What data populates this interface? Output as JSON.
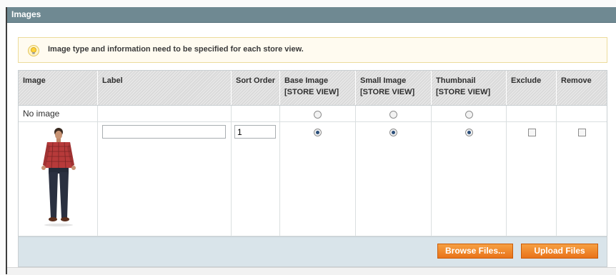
{
  "section": {
    "title": "Images"
  },
  "notice": {
    "text": "Image type and information need to be specified for each store view.",
    "icon": "lightbulb-icon"
  },
  "table": {
    "headers": {
      "image": "Image",
      "label": "Label",
      "sort_order": "Sort Order",
      "base_image": "Base Image",
      "small_image": "Small Image",
      "thumbnail": "Thumbnail",
      "scope": "[STORE VIEW]",
      "exclude": "Exclude",
      "remove": "Remove"
    },
    "no_image_label": "No image",
    "row": {
      "label_value": "",
      "sort_order_value": "1",
      "base_image_selected": true,
      "small_image_selected": true,
      "thumbnail_selected": true,
      "exclude_checked": false,
      "remove_checked": false
    }
  },
  "buttons": {
    "browse": "Browse Files...",
    "upload": "Upload Files"
  },
  "colors": {
    "header_bar": "#6f8992",
    "button_orange": "#ee7f22",
    "footer_bg": "#d9e4ea"
  }
}
